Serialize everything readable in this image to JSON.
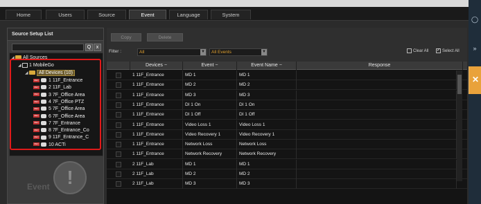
{
  "tabs": [
    {
      "label": "Home"
    },
    {
      "label": "Users"
    },
    {
      "label": "Source"
    },
    {
      "label": "Event"
    },
    {
      "label": "Language"
    },
    {
      "label": "System"
    }
  ],
  "right_edge": {
    "icons": [
      "circle-icon",
      "double-chevron-right-icon",
      "cross-icon"
    ],
    "tab_color": "#e9a23b"
  },
  "source_list": {
    "title": "Source Setup List",
    "search": {
      "value": "",
      "search_glyph": "Q",
      "clear_glyph": "x"
    },
    "tree": {
      "root": "All Sources",
      "mobilego": "1 MobileGo",
      "all_devices": "All Devices (10)",
      "devices": [
        "1  11F_Entrance",
        "2  11F_Lab",
        "3  7F_Office  Area",
        "4  7F_Office  PTZ",
        "5  7F_Office  Area",
        "6  7F_Office  Area",
        "7  7F_Entrance",
        "8  7F_Entrance_Co",
        "9  11F_Entrance_C",
        "10  ACTi"
      ]
    },
    "highlight_color": "#e01a1a"
  },
  "watermark": {
    "text": "Event",
    "bubble_glyph": "!"
  },
  "toolbar": {
    "copy_label": "Copy",
    "delete_label": "Delete"
  },
  "filter": {
    "label": "Filter :",
    "device_value": "All",
    "event_value": "All Events",
    "clear_all": "Clear All",
    "select_all": "Select All",
    "accent_color": "#e0a030"
  },
  "table": {
    "headers": {
      "devices": "Devices",
      "event": "Event",
      "event_name": "Event Name",
      "response": "Response"
    },
    "sort_glyph": "−",
    "rows": [
      {
        "device": "1 11F_Entrance",
        "event": "MD 1",
        "event_name": "MD 1",
        "response": ""
      },
      {
        "device": "1 11F_Entrance",
        "event": "MD 2",
        "event_name": "MD 2",
        "response": ""
      },
      {
        "device": "1 11F_Entrance",
        "event": "MD 3",
        "event_name": "MD 3",
        "response": ""
      },
      {
        "device": "1 11F_Entrance",
        "event": "DI 1 On",
        "event_name": "DI 1 On",
        "response": ""
      },
      {
        "device": "1 11F_Entrance",
        "event": "DI 1 Off",
        "event_name": "DI 1 Off",
        "response": ""
      },
      {
        "device": "1 11F_Entrance",
        "event": "Video Loss 1",
        "event_name": "Video Loss 1",
        "response": ""
      },
      {
        "device": "1 11F_Entrance",
        "event": "Video Recovery 1",
        "event_name": "Video Recovery 1",
        "response": ""
      },
      {
        "device": "1 11F_Entrance",
        "event": "Network Loss",
        "event_name": "Network Loss",
        "response": ""
      },
      {
        "device": "1 11F_Entrance",
        "event": "Network Recovery",
        "event_name": "Network Recovery",
        "response": ""
      },
      {
        "device": "2 11F_Lab",
        "event": "MD 1",
        "event_name": "MD 1",
        "response": ""
      },
      {
        "device": "2 11F_Lab",
        "event": "MD 2",
        "event_name": "MD 2",
        "response": ""
      },
      {
        "device": "2 11F_Lab",
        "event": "MD 3",
        "event_name": "MD 3",
        "response": ""
      }
    ]
  }
}
